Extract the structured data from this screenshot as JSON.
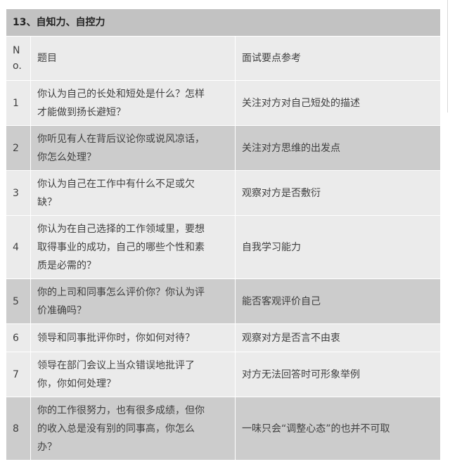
{
  "section_title": "13、自知力、自控力",
  "header": {
    "no_line1": "N",
    "no_line2": "o.",
    "question": "题目",
    "points": "面试要点参考"
  },
  "rows": [
    {
      "no": "1",
      "question": [
        "你认为自己的长处和短处是什么？怎样",
        "才能做到扬长避短？"
      ],
      "point": "关注对方对自己短处的描述"
    },
    {
      "no": "2",
      "question": [
        "你听见有人在背后议论你或说风凉话，",
        "你怎么处理？"
      ],
      "point": "关注对方思维的出发点"
    },
    {
      "no": "3",
      "question": [
        "你认为自己在工作中有什么不足或欠",
        "缺？"
      ],
      "point": "观察对方是否敷衍"
    },
    {
      "no": "4",
      "question": [
        "你认为在自己选择的工作领域里，要想",
        "取得事业的成功，自己的哪些个性和素",
        "质是必需的？"
      ],
      "point": "自我学习能力"
    },
    {
      "no": "5",
      "question": [
        "你的上司和同事怎么评价你？你认为评",
        "价准确吗？"
      ],
      "point": "能否客观评价自己"
    },
    {
      "no": "6",
      "question": [
        "领导和同事批评你时，你如何对待？"
      ],
      "point": "观察对方是否言不由衷"
    },
    {
      "no": "7",
      "question": [
        "领导在部门会议上当众错误地批评了",
        "你，你如何处理？"
      ],
      "point": "对方无法回答时可形象举例"
    },
    {
      "no": "8",
      "question": [
        "你的工作很努力，也有很多成绩，但你",
        "的收入总是没有别的同事高，你怎么",
        "办？"
      ],
      "point": "一味只会“调整心态”的也并不可取"
    }
  ]
}
